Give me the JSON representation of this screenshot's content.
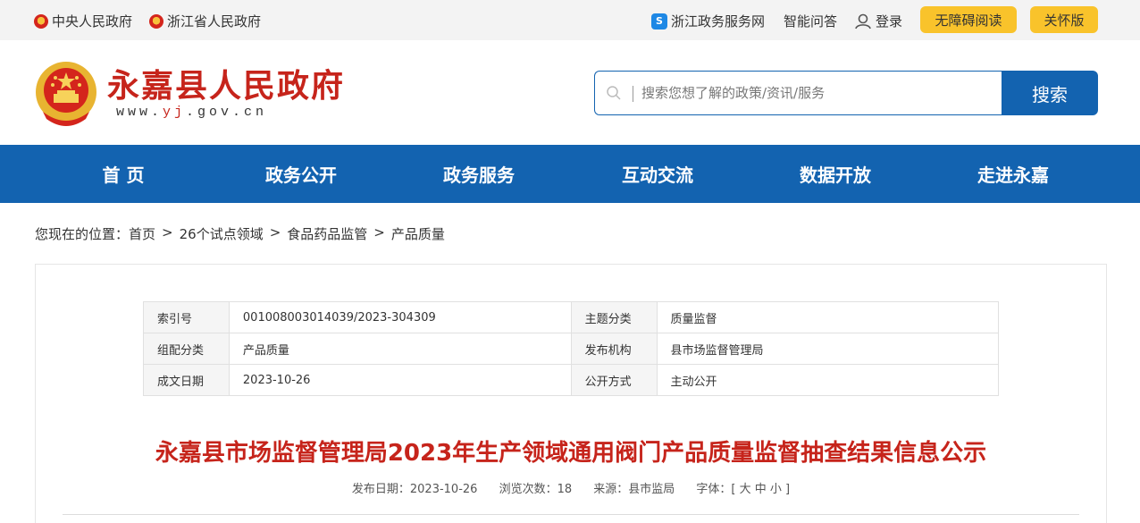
{
  "topbar": {
    "central_gov": "中央人民政府",
    "zhejiang_gov": "浙江省人民政府",
    "zj_service": "浙江政务服务网",
    "smart_qa": "智能问答",
    "login": "登录",
    "accessibility": "无障碍阅读",
    "care_mode": "关怀版"
  },
  "header": {
    "site_title": "永嘉县人民政府",
    "url_prefix": "www.",
    "url_highlight": "yj",
    "url_suffix": ".gov.cn",
    "search_placeholder": "搜索您想了解的政策/资讯/服务",
    "search_button": "搜索"
  },
  "nav": {
    "items": [
      "首 页",
      "政务公开",
      "政务服务",
      "互动交流",
      "数据开放",
      "走进永嘉"
    ]
  },
  "breadcrumb": {
    "prefix": "您现在的位置：",
    "items": [
      "首页",
      "26个试点领域",
      "食品药品监管",
      "产品质量"
    ],
    "separator": ">"
  },
  "meta": {
    "rows": [
      {
        "k1": "索引号",
        "v1": "001008003014039/2023-304309",
        "k2": "主题分类",
        "v2": "质量监督"
      },
      {
        "k1": "组配分类",
        "v1": "产品质量",
        "k2": "发布机构",
        "v2": "县市场监督管理局"
      },
      {
        "k1": "成文日期",
        "v1": "2023-10-26",
        "k2": "公开方式",
        "v2": "主动公开"
      }
    ]
  },
  "article": {
    "title": "永嘉县市场监督管理局2023年生产领域通用阀门产品质量监督抽查结果信息公示",
    "publish_date": "发布日期：2023-10-26",
    "views": "浏览次数：18",
    "source": "来源：县市监局",
    "font_size": "字体：[ 大 中 小 ]"
  },
  "colors": {
    "brand_red": "#c6241b",
    "nav_blue": "#1363b0",
    "pill_yellow": "#f9c32b"
  }
}
